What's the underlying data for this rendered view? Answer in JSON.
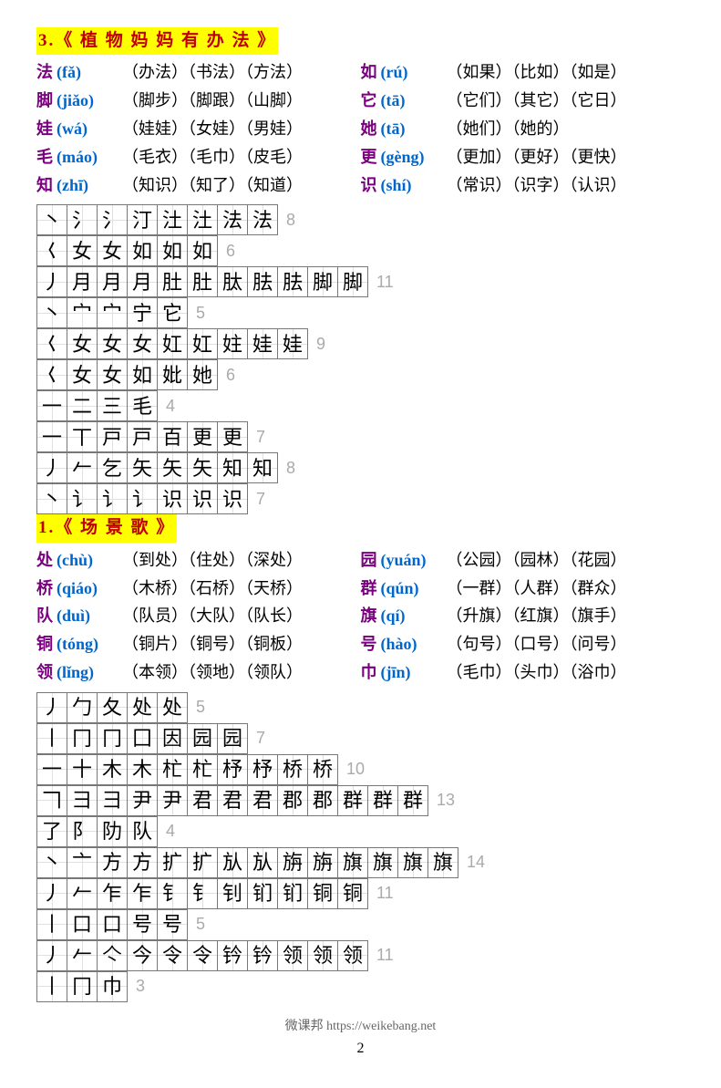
{
  "sections": [
    {
      "title": "3.《 植 物 妈 妈 有 办 法 》",
      "left": [
        {
          "char": "法",
          "pinyin": "(fǎ)",
          "words": "（办法）（书法）（方法）"
        },
        {
          "char": "脚",
          "pinyin": "(jiǎo)",
          "words": "（脚步）（脚跟）（山脚）"
        },
        {
          "char": "娃",
          "pinyin": "(wá)",
          "words": "（娃娃）（女娃）（男娃）"
        },
        {
          "char": "毛",
          "pinyin": "(máo)",
          "words": "（毛衣）（毛巾）（皮毛）"
        },
        {
          "char": "知",
          "pinyin": "(zhī)",
          "words": "（知识）（知了）（知道）"
        }
      ],
      "right": [
        {
          "char": "如",
          "pinyin": "(rú)",
          "words": "（如果）（比如）（如是）"
        },
        {
          "char": "它",
          "pinyin": "(tā)",
          "words": "（它们）（其它）（它日）"
        },
        {
          "char": "她",
          "pinyin": "(tā)",
          "words": "（她们）（她的）"
        },
        {
          "char": "更",
          "pinyin": "(gèng)",
          "words": "（更加）（更好）（更快）"
        },
        {
          "char": "识",
          "pinyin": "(shí)",
          "words": "（常识）（识字）（认识）"
        }
      ],
      "strokes": [
        {
          "seq": [
            "丶",
            "氵",
            "氵",
            "汀",
            "汢",
            "汢",
            "法",
            "法"
          ],
          "count": 8
        },
        {
          "seq": [
            "𡿨",
            "女",
            "女",
            "如",
            "如",
            "如"
          ],
          "count": 6
        },
        {
          "seq": [
            "丿",
            "月",
            "月",
            "月",
            "肚",
            "肚",
            "肽",
            "胠",
            "胠",
            "脚",
            "脚"
          ],
          "count": 11
        },
        {
          "seq": [
            "丶",
            "宀",
            "宀",
            "宁",
            "它"
          ],
          "count": 5
        },
        {
          "seq": [
            "𡿨",
            "女",
            "女",
            "女",
            "妅",
            "妅",
            "妵",
            "娃",
            "娃"
          ],
          "count": 9
        },
        {
          "seq": [
            "𡿨",
            "女",
            "女",
            "如",
            "妣",
            "她"
          ],
          "count": 6
        },
        {
          "seq": [
            "一",
            "二",
            "三",
            "毛"
          ],
          "count": 4
        },
        {
          "seq": [
            "一",
            "丅",
            "戸",
            "戸",
            "百",
            "更",
            "更"
          ],
          "count": 7
        },
        {
          "seq": [
            "丿",
            "𠂉",
            "乞",
            "矢",
            "矢",
            "矢",
            "知",
            "知"
          ],
          "count": 8
        },
        {
          "seq": [
            "丶",
            "讠",
            "讠",
            "讠",
            "识",
            "识",
            "识"
          ],
          "count": 7
        }
      ]
    },
    {
      "title": "1.《 场 景 歌  》",
      "left": [
        {
          "char": "处",
          "pinyin": "(chù)",
          "words": "（到处）（住处）（深处）"
        },
        {
          "char": "桥",
          "pinyin": "(qiáo)",
          "words": "（木桥）（石桥）（天桥）"
        },
        {
          "char": "队",
          "pinyin": "(duì)",
          "words": "（队员）（大队）（队长）"
        },
        {
          "char": "铜",
          "pinyin": "(tóng)",
          "words": "（铜片）（铜号）（铜板）"
        },
        {
          "char": "领",
          "pinyin": "(lǐng)",
          "words": "（本领）（领地）（领队）"
        }
      ],
      "right": [
        {
          "char": "园",
          "pinyin": "(yuán)",
          "words": "（公园）（园林）（花园）"
        },
        {
          "char": "群",
          "pinyin": "(qún)",
          "words": "（一群）（人群）（群众）"
        },
        {
          "char": "旗",
          "pinyin": "(qí)",
          "words": "（升旗）（红旗）（旗手）"
        },
        {
          "char": "号",
          "pinyin": "(hào)",
          "words": "（句号）（口号）（问号）"
        },
        {
          "char": "巾",
          "pinyin": " (jīn)",
          "words": "（毛巾）（头巾）（浴巾）"
        }
      ],
      "strokes": [
        {
          "seq": [
            "丿",
            "勹",
            "夂",
            "处",
            "处"
          ],
          "count": 5
        },
        {
          "seq": [
            "丨",
            "冂",
            "冂",
            "囗",
            "因",
            "园",
            "园"
          ],
          "count": 7
        },
        {
          "seq": [
            "一",
            "十",
            "木",
            "木",
            "杧",
            "杧",
            "杼",
            "杼",
            "桥",
            "桥"
          ],
          "count": 10
        },
        {
          "seq": [
            "𠃍",
            "彐",
            "彐",
            "尹",
            "尹",
            "君",
            "君",
            "君",
            "郡",
            "郡",
            "群",
            "群",
            "群"
          ],
          "count": 13
        },
        {
          "seq": [
            "了",
            "阝",
            "阞",
            "队"
          ],
          "count": 4
        },
        {
          "seq": [
            "丶",
            "亠",
            "方",
            "方",
            "扩",
            "扩",
            "㫃",
            "㫃",
            "旃",
            "旃",
            "旗",
            "旗",
            "旗",
            "旗"
          ],
          "count": 14
        },
        {
          "seq": [
            "丿",
            "𠂉",
            "乍",
            "乍",
            "钅",
            "钅",
            "钊",
            "钔",
            "钔",
            "铜",
            "铜"
          ],
          "count": 11
        },
        {
          "seq": [
            "丨",
            "口",
            "口",
            "号",
            "号"
          ],
          "count": 5
        },
        {
          "seq": [
            "丿",
            "𠂉",
            "亽",
            "今",
            "令",
            "令",
            "钤",
            "钤",
            "领",
            "领",
            "领"
          ],
          "count": 11
        },
        {
          "seq": [
            "丨",
            "冂",
            "巾"
          ],
          "count": 3
        }
      ]
    }
  ],
  "footer": "微课邦 https://weikebang.net",
  "page": "2"
}
